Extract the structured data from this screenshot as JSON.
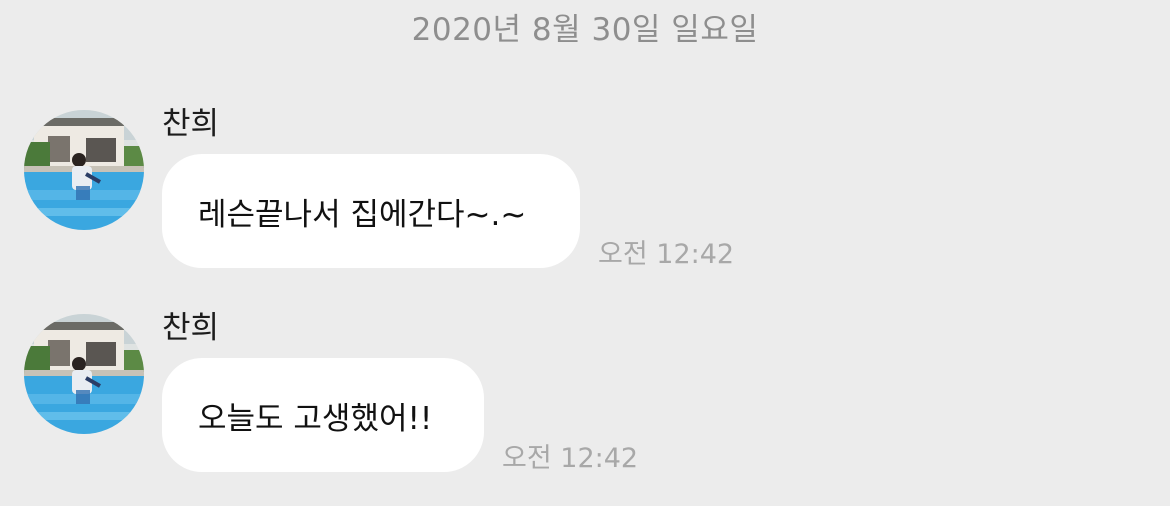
{
  "date_header": "2020년 8월 30일 일요일",
  "messages": [
    {
      "sender": "찬희",
      "text": "레슨끝나서 집에간다~.~",
      "time": "오전 12:42"
    },
    {
      "sender": "찬희",
      "text": "오늘도 고생했어!!",
      "time": "오전 12:42"
    }
  ],
  "colors": {
    "background": "#ececec",
    "bubble": "#ffffff",
    "meta_text": "#a8a8a8",
    "date_text": "#8e8e8e",
    "pool_water": "#3aa7e0"
  },
  "avatar_icon": "profile-photo-pool"
}
